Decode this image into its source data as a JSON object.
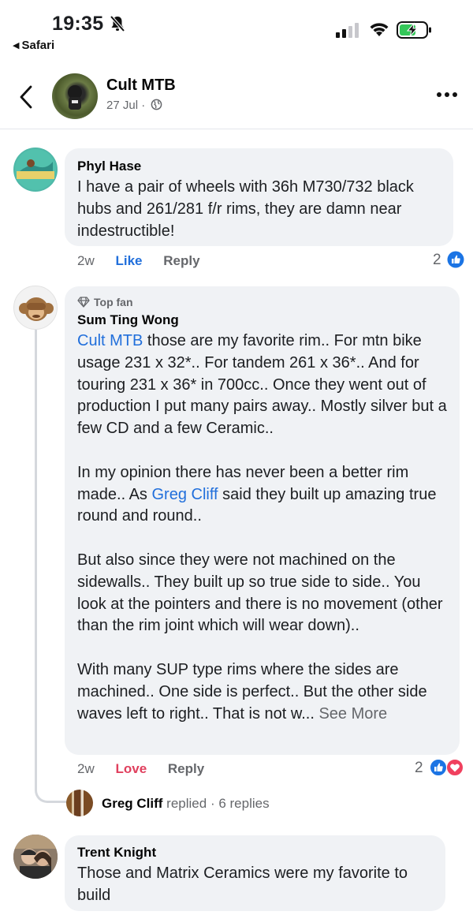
{
  "status_bar": {
    "time": "19:35",
    "back_app": "Safari"
  },
  "header": {
    "title": "Cult MTB",
    "date": "27 Jul",
    "separator": "·"
  },
  "comments": [
    {
      "name": "Phyl Hase",
      "text": "I have a pair of wheels with 36h M730/732 black hubs and 261/281 f/r rims, they are damn near indestructible!",
      "time": "2w",
      "reaction_action": "Like",
      "reply_action": "Reply",
      "reaction_count": "2"
    },
    {
      "badge": "Top fan",
      "name": "Sum Ting Wong",
      "p1_mention": "Cult MTB",
      "p1_text": " those are my favorite rim.. For mtn bike usage 231 x 32*.. For tandem 261 x 36*.. And for touring 231 x 36* in 700cc.. Once they went out of production I put many pairs away.. Mostly silver but a few CD and a few Ceramic..",
      "p2_a": "In my opinion there has never been a better rim made.. As ",
      "p2_mention": "Greg Cliff",
      "p2_b": " said they built up amazing true round and round..",
      "p3": "But also since they were not machined on the sidewalls.. They built up so true side to side.. You look at the pointers and there is no movement (other than the rim joint which will wear down)..",
      "p4": "With many SUP type rims where the sides are machined.. One side is perfect.. But the other side waves left to right.. That is not w... ",
      "see_more": "See More",
      "time": "2w",
      "reaction_action": "Love",
      "reply_action": "Reply",
      "reaction_count": "2",
      "replies_summary": {
        "name": "Greg Cliff",
        "verb": " replied",
        "count": " · 6 replies"
      }
    },
    {
      "name": "Trent Knight",
      "text": "Those and Matrix Ceramics were my favorite to build"
    }
  ],
  "colors": {
    "like_blue": "#216fdb",
    "love_red": "#e0405e",
    "bubble_bg": "#f0f2f5"
  },
  "icons": [
    "bell-slash-icon",
    "signal-icon",
    "wifi-icon",
    "battery-charging-icon",
    "back-chevron-icon",
    "globe-icon",
    "more-dots-icon",
    "diamond-icon",
    "like-icon",
    "love-icon"
  ]
}
